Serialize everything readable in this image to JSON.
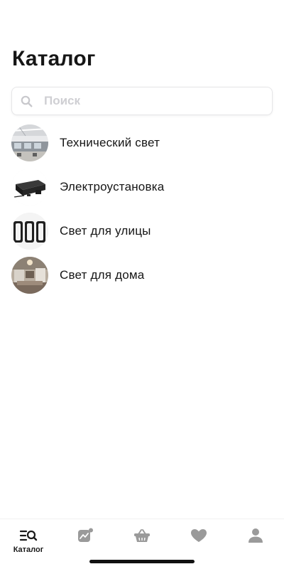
{
  "header": {
    "title": "Каталог"
  },
  "search": {
    "placeholder": "Поиск",
    "value": "",
    "icon": "search-icon"
  },
  "catalog": {
    "items": [
      {
        "label": "Технический свет",
        "image": "technical-light-thumbnail"
      },
      {
        "label": "Электроустановка",
        "image": "electrical-installation-thumbnail"
      },
      {
        "label": "Свет для улицы",
        "image": "outdoor-light-thumbnail"
      },
      {
        "label": "Свет для дома",
        "image": "home-light-thumbnail"
      }
    ]
  },
  "tabbar": {
    "active_color": "#1a1a1a",
    "inactive_color": "#9a9a9a",
    "tabs": [
      {
        "label": "Каталог",
        "icon": "catalog-icon",
        "active": true
      },
      {
        "label": "",
        "icon": "chart-icon",
        "active": false
      },
      {
        "label": "",
        "icon": "basket-icon",
        "active": false
      },
      {
        "label": "",
        "icon": "heart-icon",
        "active": false
      },
      {
        "label": "",
        "icon": "profile-icon",
        "active": false
      }
    ]
  }
}
